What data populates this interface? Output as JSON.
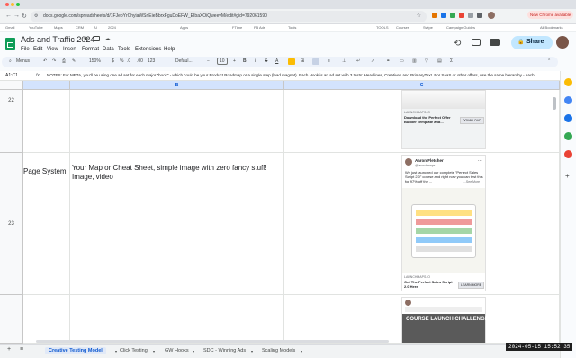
{
  "browser": {
    "url": "docs.google.com/spreadsheets/d/1FJeoYrChyiaWSnEieBbrxFguDoEFW_EIbaXOiQweevM/edit#gid=792061590",
    "update_label": "New Chrome available",
    "bookmarks": [
      "Gmail",
      "YouTube",
      "Maps",
      "CRM",
      "AI",
      "2024",
      "Apps",
      "FTime",
      "FB Ads",
      "Tools",
      "TOOLS",
      "Courses",
      "Swipe",
      "Campaign Guides"
    ],
    "all_bookmarks": "All Bookmarks"
  },
  "doc": {
    "title": "Ads and Traffic 2024",
    "menus": [
      "File",
      "Edit",
      "View",
      "Insert",
      "Format",
      "Data",
      "Tools",
      "Extensions",
      "Help"
    ],
    "share_label": "Share"
  },
  "toolbar": {
    "search": "Menus",
    "zoom": "150%",
    "font": "Defaul...",
    "font_size": "10",
    "currency": "$",
    "percent": "%",
    "dec1": ".0",
    "dec2": ".00",
    "number_format": "123"
  },
  "formula": {
    "cell_ref": "A1:C1",
    "fx": "fx",
    "content": "NOTES: For META, you'll be using one ad set for each major \"hook\" - which could be your Product Roadmap or a single step (lead magnet). Each Hook is an ad set with 3 tests: Headlines, Creatives and PrimaryText.  For SaaS or other offers, use the same hierarchy - each"
  },
  "columns": [
    "B",
    "C"
  ],
  "rows": [
    {
      "num": "22",
      "a": "",
      "b": "",
      "ad": {
        "brand": "LAUNCHMAPS.IO",
        "headline": "Download the Perfect Offer Builder Template and...",
        "cta": "DOWNLOAD"
      }
    },
    {
      "num": "23",
      "a": "Page System",
      "b": "Your Map or Cheat Sheet, simple image with zero fancy stuff! Image, video",
      "ad": {
        "author": "Aaron Fletcher",
        "handle": "@launchmaps",
        "body": "We just launched our complete \"Perfect Sales Script 2.0\" course and right now you can test this for 97% off the ...",
        "see_more": "...See More",
        "brand": "LAUNCHMAPS.IO",
        "headline": "Get The Perfect Sales Script 2.0 Here",
        "cta": "LEARN MORE"
      }
    },
    {
      "num": "",
      "a": "",
      "b": "",
      "ad": {
        "banner": "COURSE LAUNCH CHALLENGE"
      }
    }
  ],
  "tabs": [
    "+",
    "≡",
    "Creative Testing Model",
    "Click Testing",
    "GW Hooks",
    "SDC - Winning Ads",
    "Scaling Models"
  ],
  "timestamp": "2024-05-15  15:52:35",
  "colors": {
    "accent": "#0b57d0",
    "header": "#d3e3fd",
    "sheets_green": "#0f9d58"
  }
}
